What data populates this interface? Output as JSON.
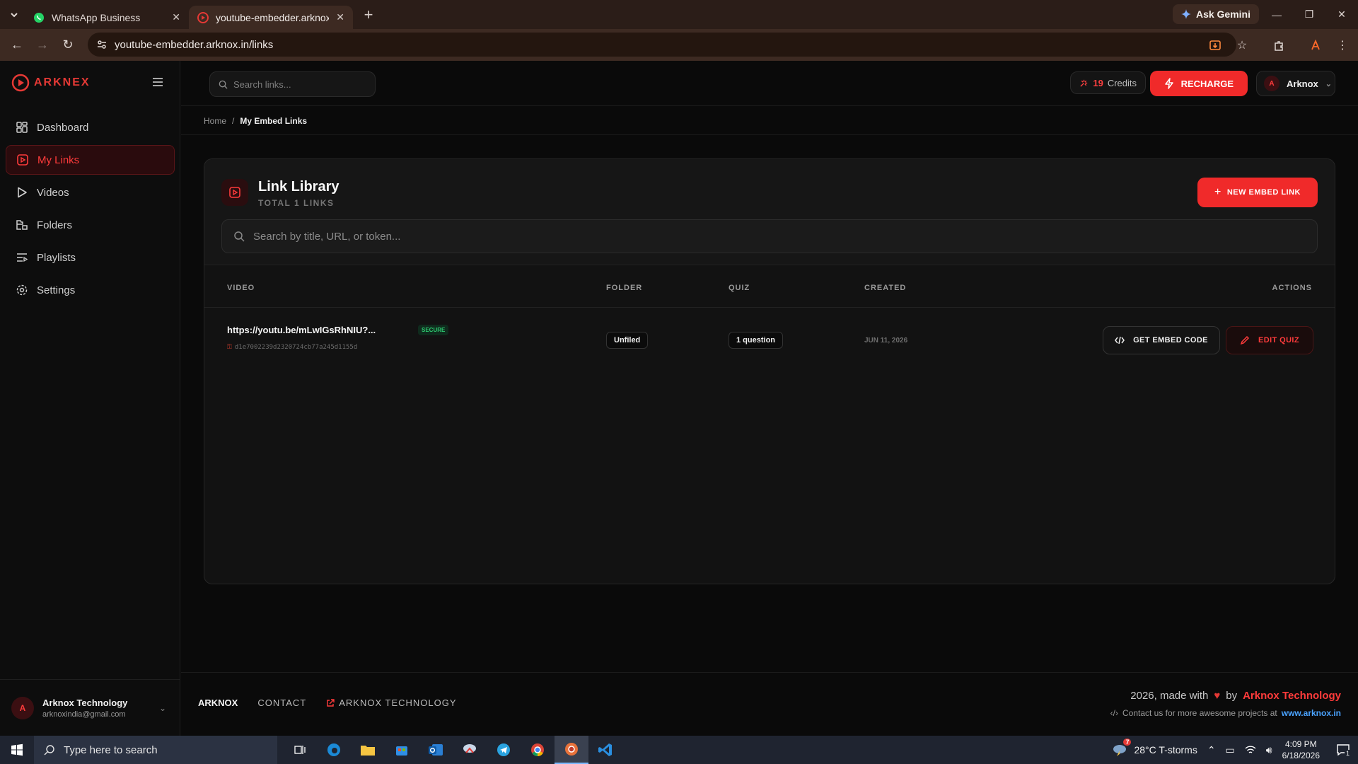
{
  "browser": {
    "tabs": [
      {
        "title": "WhatsApp Business",
        "icon": "whatsapp-icon"
      },
      {
        "title": "youtube-embedder.arknox.in/li",
        "icon": "arknex-icon"
      }
    ],
    "gemini_label": "Ask Gemini",
    "url": "youtube-embedder.arknox.in/links"
  },
  "app": {
    "logo_text": "ARKNEX",
    "sidebar": {
      "items": [
        {
          "label": "Dashboard",
          "icon": "dashboard-icon"
        },
        {
          "label": "My Links",
          "icon": "links-icon"
        },
        {
          "label": "Videos",
          "icon": "play-icon"
        },
        {
          "label": "Folders",
          "icon": "folder-icon"
        },
        {
          "label": "Playlists",
          "icon": "playlist-icon"
        },
        {
          "label": "Settings",
          "icon": "gear-icon"
        }
      ],
      "user": {
        "initial": "A",
        "name": "Arknox Technology",
        "email": "arknoxindia@gmail.com"
      }
    },
    "header": {
      "search_placeholder": "Search links...",
      "credits_value": "19",
      "credits_label": "Credits",
      "recharge_label": "RECHARGE",
      "user_initial": "A",
      "user_name": "Arknox"
    },
    "breadcrumb": {
      "home": "Home",
      "separator": "/",
      "current": "My Embed Links"
    },
    "library": {
      "title": "Link Library",
      "subtitle": "TOTAL 1 LINKS",
      "new_button": "NEW EMBED LINK",
      "search_placeholder": "Search by title, URL, or token...",
      "columns": {
        "video": "VIDEO",
        "folder": "FOLDER",
        "quiz": "QUIZ",
        "created": "CREATED",
        "actions": "ACTIONS"
      },
      "rows": [
        {
          "url": "https://youtu.be/mLwIGsRhNIU?...",
          "badge": "SECURE",
          "token": "d1e7002239d2320724cb77a245d1155d",
          "folder": "Unfiled",
          "quiz": "1 question",
          "created": "JUN 11, 2026",
          "embed_label": "GET EMBED CODE",
          "edit_label": "EDIT QUIZ"
        }
      ]
    },
    "footer": {
      "brand": "ARKNOX",
      "contact": "CONTACT",
      "tech": "ARKNOX TECHNOLOGY",
      "made_prefix": "2026, made with",
      "made_by": "by",
      "made_company": "Arknox Technology",
      "contact_text": "Contact us for more awesome projects at",
      "contact_site": "www.arknox.in"
    }
  },
  "taskbar": {
    "search_placeholder": "Type here to search",
    "weather": "28°C  T-storms",
    "weather_badge": "7",
    "time": "4:09 PM",
    "date": "6/18/2026",
    "notification_count": "1"
  },
  "colors": {
    "accent": "#f02a2a",
    "background": "#0a0a0a",
    "secure_green": "#2ecc71",
    "link_blue": "#4aa3ff"
  }
}
